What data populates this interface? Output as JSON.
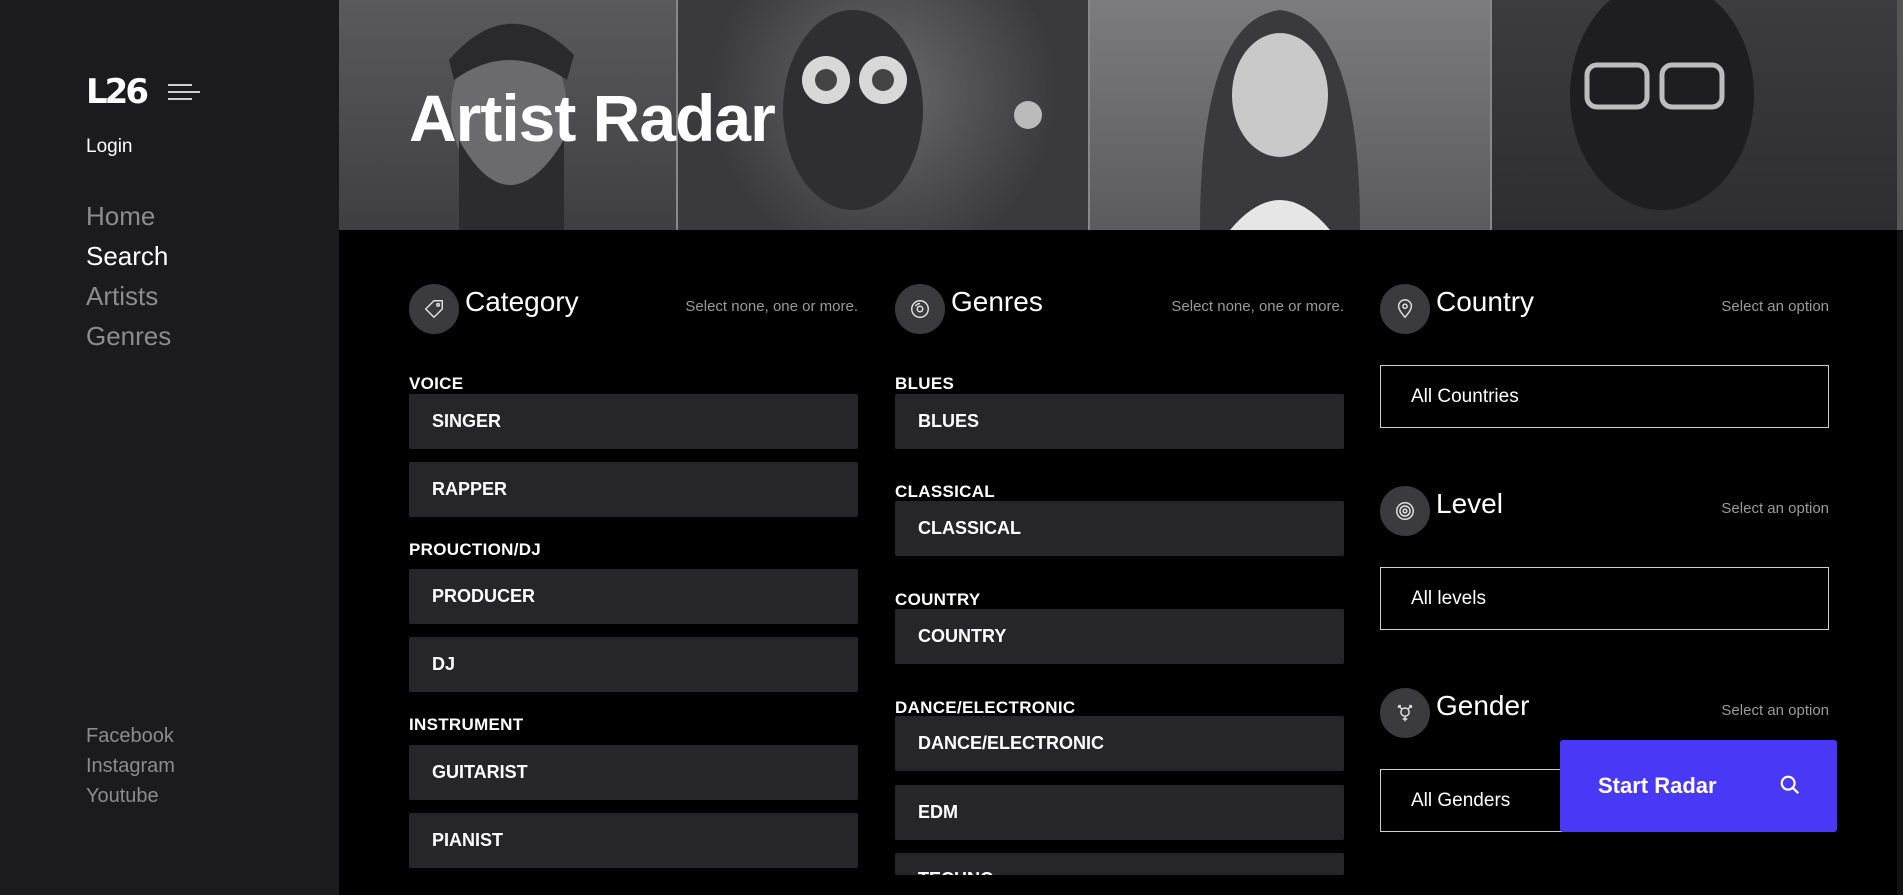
{
  "sidebar": {
    "logo": "L26",
    "login": "Login",
    "nav": [
      "Home",
      "Search",
      "Artists",
      "Genres"
    ],
    "active_nav": "Search",
    "social": [
      "Facebook",
      "Instagram",
      "Youtube"
    ]
  },
  "hero": {
    "title": "Artist Radar"
  },
  "category": {
    "title": "Category",
    "hint": "Select none, one or more.",
    "groups": [
      {
        "label": "VOICE",
        "items": [
          "SINGER",
          "RAPPER"
        ]
      },
      {
        "label": "PROUCTION/DJ",
        "items": [
          "PRODUCER",
          "DJ"
        ]
      },
      {
        "label": "INSTRUMENT",
        "items": [
          "GUITARIST",
          "PIANIST"
        ]
      }
    ]
  },
  "genres": {
    "title": "Genres",
    "hint": "Select none, one or more.",
    "groups": [
      {
        "label": "BLUES",
        "items": [
          "BLUES"
        ]
      },
      {
        "label": "CLASSICAL",
        "items": [
          "CLASSICAL"
        ]
      },
      {
        "label": "COUNTRY",
        "items": [
          "COUNTRY"
        ]
      },
      {
        "label": "DANCE/ELECTRONIC",
        "items": [
          "DANCE/ELECTRONIC",
          "EDM",
          "TECHNO"
        ]
      }
    ]
  },
  "country": {
    "title": "Country",
    "hint": "Select an option",
    "value": "All Countries"
  },
  "level": {
    "title": "Level",
    "hint": "Select an option",
    "value": "All levels"
  },
  "gender": {
    "title": "Gender",
    "hint": "Select an option",
    "value": "All Genders"
  },
  "start_button": {
    "label": "Start Radar"
  },
  "colors": {
    "accent": "#4938f5",
    "sidebar_bg": "#1b1b1d",
    "chip_bg": "#262628"
  }
}
